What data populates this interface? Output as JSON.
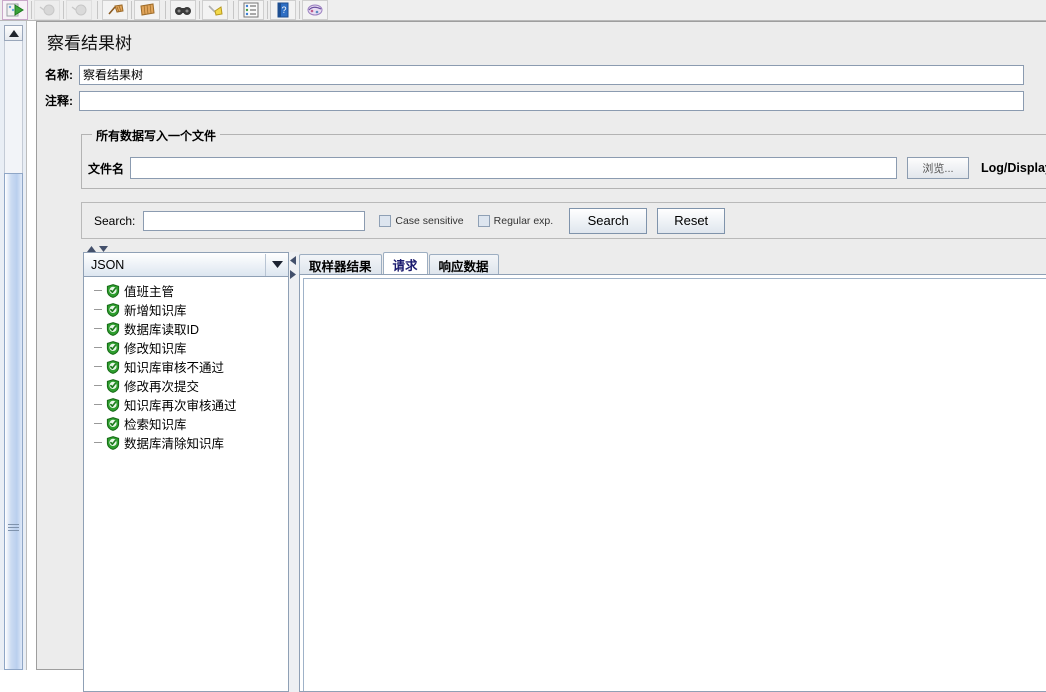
{
  "toolbar": {
    "buttons": [
      {
        "name": "start-button",
        "icon": "start-icon",
        "state": "selected"
      },
      {
        "name": "stop-button",
        "icon": "stop-icon",
        "state": "disabled"
      },
      {
        "name": "shutdown-button",
        "icon": "shutdown-icon",
        "state": "disabled"
      },
      {
        "name": "clear-button",
        "icon": "broom-icon",
        "state": "normal"
      },
      {
        "name": "clear-all-button",
        "icon": "broom-all-icon",
        "state": "normal"
      },
      {
        "name": "search-toolbar-button",
        "icon": "binoculars-icon",
        "state": "normal"
      },
      {
        "name": "reset-search-button",
        "icon": "yellow-broom-icon",
        "state": "normal"
      },
      {
        "name": "log-viewer-button",
        "icon": "log-list-icon",
        "state": "normal"
      },
      {
        "name": "help-button",
        "icon": "help-book-icon",
        "state": "normal"
      },
      {
        "name": "function-helper-button",
        "icon": "function-helper-icon",
        "state": "normal"
      }
    ]
  },
  "panel": {
    "title": "察看结果树",
    "name_label": "名称:",
    "name_value": "察看结果树",
    "comment_label": "注释:",
    "comment_value": ""
  },
  "file_group": {
    "title": "所有数据写入一个文件",
    "filename_label": "文件名",
    "filename_value": "",
    "browse_label": "浏览...",
    "log_display_label": "Log/Display"
  },
  "search": {
    "label": "Search:",
    "value": "",
    "case_sensitive_label": "Case sensitive",
    "case_sensitive_checked": false,
    "regular_exp_label": "Regular exp.",
    "regular_exp_checked": false,
    "search_button": "Search",
    "reset_button": "Reset"
  },
  "tree": {
    "renderer_selected": "JSON",
    "items": [
      {
        "label": "值班主管",
        "status": "success"
      },
      {
        "label": "新增知识库",
        "status": "success"
      },
      {
        "label": "数据库读取ID",
        "status": "success"
      },
      {
        "label": "修改知识库",
        "status": "success"
      },
      {
        "label": "知识库审核不通过",
        "status": "success"
      },
      {
        "label": "修改再次提交",
        "status": "success"
      },
      {
        "label": "知识库再次审核通过",
        "status": "success"
      },
      {
        "label": "检索知识库",
        "status": "success"
      },
      {
        "label": "数据库清除知识库",
        "status": "success"
      }
    ]
  },
  "tabs": {
    "items": [
      {
        "label": "取样器结果",
        "active": false
      },
      {
        "label": "请求",
        "active": true
      },
      {
        "label": "响应数据",
        "active": false
      }
    ],
    "content": ""
  },
  "colors": {
    "panel_background": "#ececec",
    "accent_blue": "#b9cfee",
    "success_green": "#2e9e2e",
    "active_tab_text": "#1a1a6e"
  }
}
